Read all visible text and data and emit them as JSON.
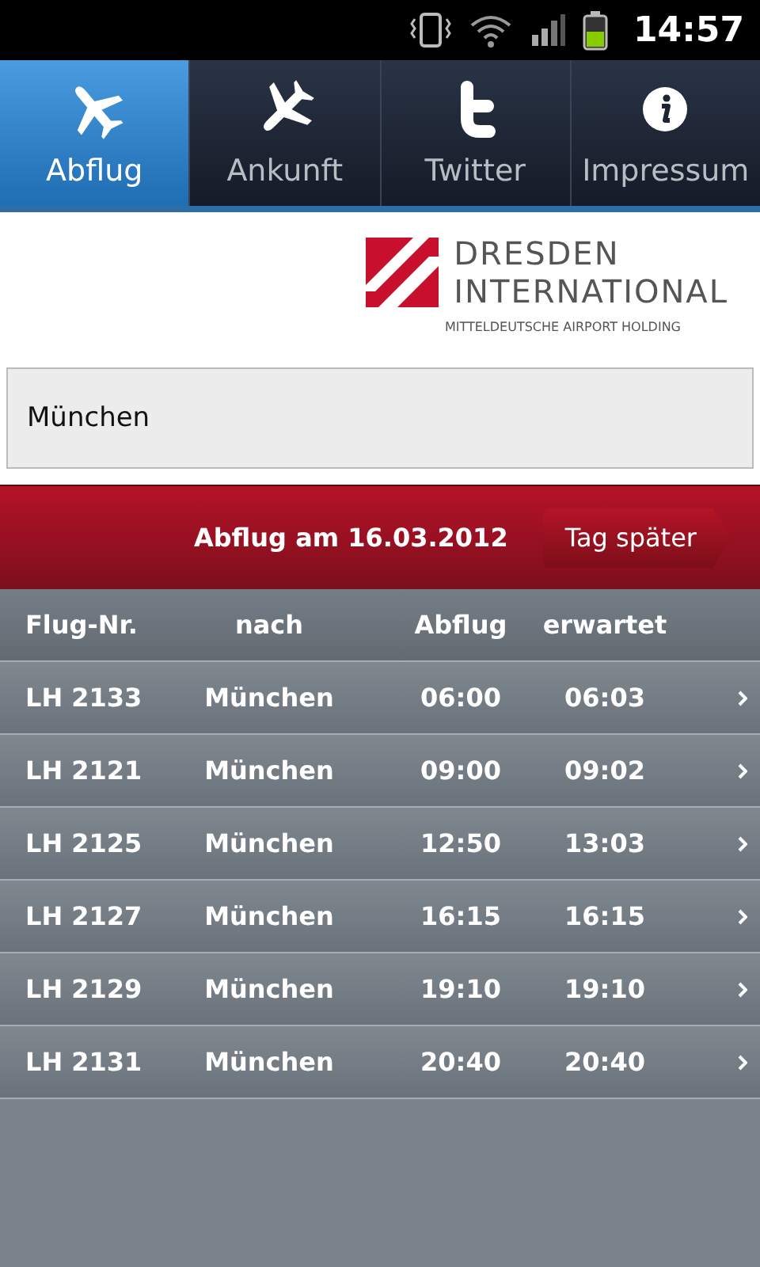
{
  "status_bar": {
    "time": "14:57"
  },
  "tabs": [
    {
      "label": "Abflug",
      "selected": true
    },
    {
      "label": "Ankunft",
      "selected": false
    },
    {
      "label": "Twitter",
      "selected": false
    },
    {
      "label": "Impressum",
      "selected": false
    }
  ],
  "logo": {
    "line_1": "DRESDEN",
    "line_2": "INTERNATIONAL",
    "tagline": "MITTELDEUTSCHE AIRPORT HOLDING"
  },
  "search": {
    "value": "München"
  },
  "date_bar": {
    "title": "Abflug am 16.03.2012",
    "button": "Tag später"
  },
  "table": {
    "columns": [
      "Flug-Nr.",
      "nach",
      "Abflug",
      "erwartet"
    ],
    "rows": [
      {
        "flight": "LH 2133",
        "destination": "München",
        "scheduled": "06:00",
        "expected": "06:03"
      },
      {
        "flight": "LH 2121",
        "destination": "München",
        "scheduled": "09:00",
        "expected": "09:02"
      },
      {
        "flight": "LH 2125",
        "destination": "München",
        "scheduled": "12:50",
        "expected": "13:03"
      },
      {
        "flight": "LH 2127",
        "destination": "München",
        "scheduled": "16:15",
        "expected": "16:15"
      },
      {
        "flight": "LH 2129",
        "destination": "München",
        "scheduled": "19:10",
        "expected": "19:10"
      },
      {
        "flight": "LH 2131",
        "destination": "München",
        "scheduled": "20:40",
        "expected": "20:40"
      }
    ]
  }
}
